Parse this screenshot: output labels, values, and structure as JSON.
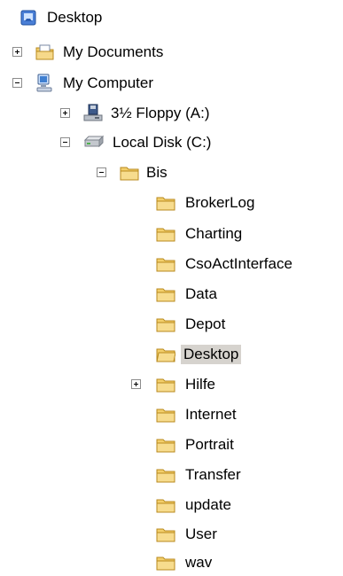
{
  "tree": {
    "desktop": "Desktop",
    "my_documents": "My Documents",
    "my_computer": "My Computer",
    "floppy": "3½ Floppy (A:)",
    "local_disk": "Local Disk (C:)",
    "bis": "Bis",
    "folders": [
      "BrokerLog",
      "Charting",
      "CsoActInterface",
      "Data",
      "Depot",
      "Desktop",
      "Hilfe",
      "Internet",
      "Portrait",
      "Transfer",
      "update",
      "User",
      "wav"
    ],
    "selected_folder": "Desktop"
  },
  "colors": {
    "folder_fill": "#f3cf6b",
    "folder_stroke": "#b88a1e",
    "selection": "#d6d3ce"
  }
}
